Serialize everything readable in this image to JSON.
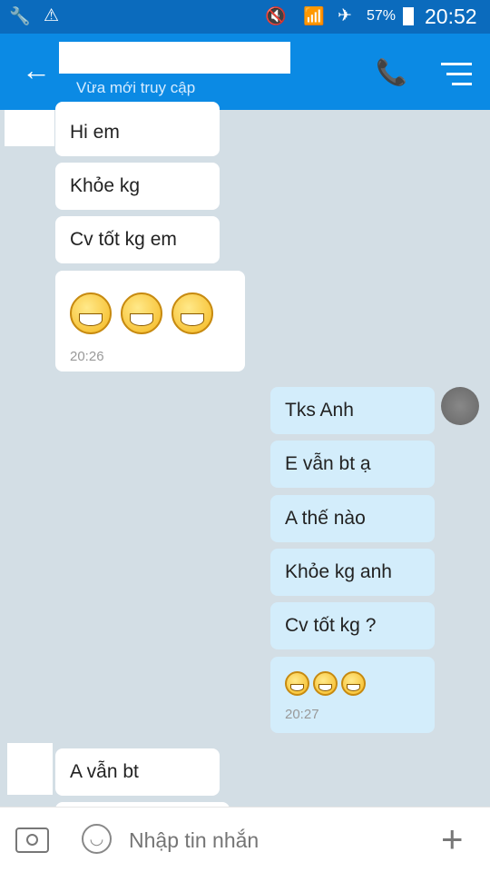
{
  "status": {
    "battery": "57%",
    "time": "20:52",
    "icons": [
      "wrench-icon",
      "warning-icon",
      "mute-vibrate-icon",
      "wifi-icon",
      "airplane-icon",
      "battery-icon"
    ]
  },
  "header": {
    "subtitle": "Vừa mới truy cập",
    "icons": [
      "back-arrow-icon",
      "phone-icon",
      "menu-icon"
    ]
  },
  "messages": {
    "incoming": [
      "Hi em",
      "Khỏe kg",
      "Cv tốt kg em"
    ],
    "incoming_time": "20:26",
    "outgoing": [
      "Tks Anh",
      "E vẫn bt ạ",
      "A thế nào",
      "Khỏe kg anh",
      "Cv tốt kg ?"
    ],
    "outgoing_time": "20:27",
    "incoming2": [
      "A vẫn bt"
    ]
  },
  "input": {
    "placeholder": "Nhập tin nhắn",
    "icons": [
      "camera-icon",
      "emoji-icon",
      "plus-icon"
    ]
  },
  "colors": {
    "header": "#0b8ae4",
    "statusbar": "#0b6bbd",
    "outgoing_bubble": "#d3edfb",
    "background": "#d3dee5"
  }
}
